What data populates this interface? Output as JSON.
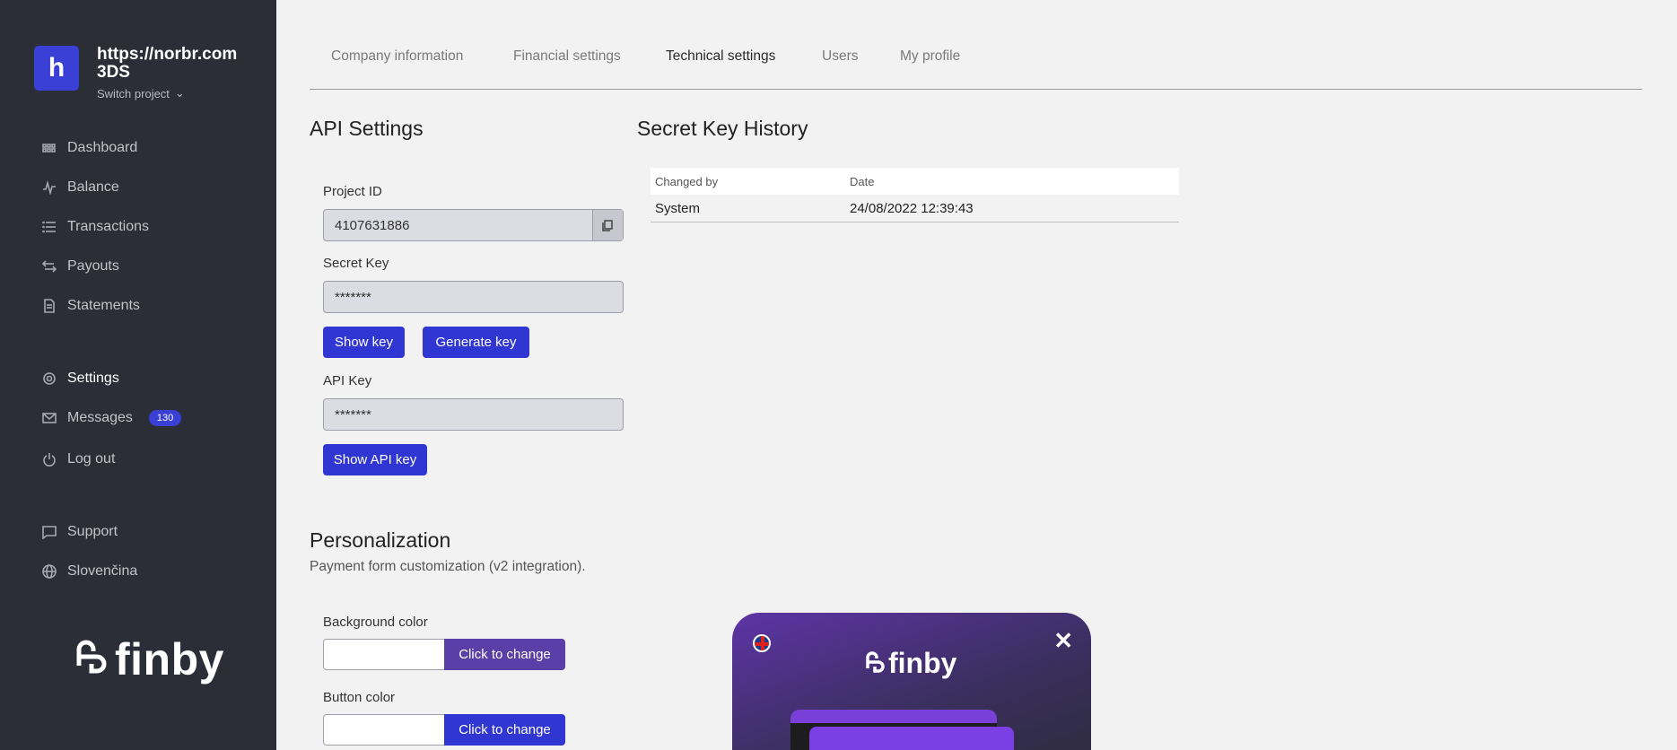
{
  "sidebar": {
    "logo_letter": "h",
    "project_name": "https://norbr.com 3DS",
    "switch_label": "Switch project",
    "items": [
      {
        "label": "Dashboard",
        "icon": "dashboard-icon"
      },
      {
        "label": "Balance",
        "icon": "activity-icon"
      },
      {
        "label": "Transactions",
        "icon": "list-icon"
      },
      {
        "label": "Payouts",
        "icon": "arrows-icon"
      },
      {
        "label": "Statements",
        "icon": "document-icon"
      },
      {
        "label": "Settings",
        "icon": "gear-icon",
        "active": true
      },
      {
        "label": "Messages",
        "icon": "mail-icon",
        "badge": "130"
      },
      {
        "label": "Log out",
        "icon": "power-icon"
      },
      {
        "label": "Support",
        "icon": "chat-icon"
      },
      {
        "label": "Slovenčina",
        "icon": "globe-icon"
      }
    ],
    "brand": "finby"
  },
  "tabs": [
    {
      "label": "Company information"
    },
    {
      "label": "Financial settings"
    },
    {
      "label": "Technical settings",
      "active": true
    },
    {
      "label": "Users"
    },
    {
      "label": "My profile"
    }
  ],
  "api": {
    "title": "API Settings",
    "project_id_label": "Project ID",
    "project_id_value": "4107631886",
    "secret_key_label": "Secret Key",
    "secret_key_value": "*******",
    "show_key": "Show key",
    "generate_key": "Generate key",
    "api_key_label": "API Key",
    "api_key_value": "*******",
    "show_api_key": "Show API key"
  },
  "history": {
    "title": "Secret Key History",
    "columns": [
      "Changed by",
      "Date"
    ],
    "rows": [
      [
        "System",
        "24/08/2022 12:39:43"
      ]
    ]
  },
  "personalization": {
    "title": "Personalization",
    "description": "Payment form customization (v2 integration).",
    "background_label": "Background color",
    "background_button": "Click to change",
    "background_color": "#5a3fa8",
    "button_label": "Button color",
    "button_button": "Click to change",
    "button_color": "#3036d2"
  },
  "preview": {
    "brand": "finby",
    "close": "✕"
  }
}
